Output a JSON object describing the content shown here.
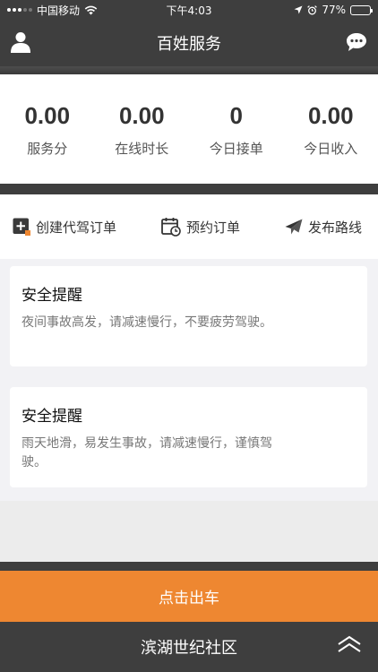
{
  "status_bar": {
    "carrier": "中国移动",
    "time": "下午4:03",
    "battery_percent": "77%",
    "battery_level": 0.77
  },
  "header": {
    "title": "百姓服务",
    "left_icon": "user-icon",
    "right_icon": "chat-bubble-icon"
  },
  "stats": [
    {
      "value": "0.00",
      "label": "服务分"
    },
    {
      "value": "0.00",
      "label": "在线时长"
    },
    {
      "value": "0",
      "label": "今日接单"
    },
    {
      "value": "0.00",
      "label": "今日收入"
    }
  ],
  "actions": [
    {
      "label": "创建代驾订单",
      "icon": "plus-square-icon"
    },
    {
      "label": "预约订单",
      "icon": "calendar-clock-icon"
    },
    {
      "label": "发布路线",
      "icon": "paper-plane-icon"
    }
  ],
  "alerts": [
    {
      "title": "安全提醒",
      "body": "夜间事故高发，请减速慢行，不要疲劳驾驶。"
    },
    {
      "title": "安全提醒",
      "body": "雨天地滑，易发生事故，请减速慢行，谨慎驾驶。"
    }
  ],
  "depart_button_label": "点击出车",
  "bottom_bar": {
    "community": "滨湖世纪社区",
    "expand_icon": "double-chevron-up-icon"
  },
  "colors": {
    "dark_bar": "#3e3e3e",
    "accent_orange": "#ee8731",
    "background": "#f2f2f5"
  }
}
